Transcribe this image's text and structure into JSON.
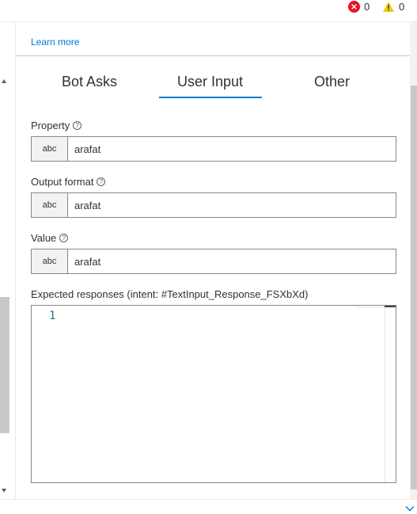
{
  "status": {
    "errors": "0",
    "warnings": "0"
  },
  "learn_more": "Learn more",
  "tabs": [
    {
      "label": "Bot Asks"
    },
    {
      "label": "User Input",
      "active": true
    },
    {
      "label": "Other"
    }
  ],
  "fields": {
    "property": {
      "label": "Property",
      "type": "abc",
      "value": "arafat"
    },
    "output_format": {
      "label": "Output format",
      "type": "abc",
      "value": "arafat"
    },
    "value": {
      "label": "Value",
      "type": "abc",
      "value": "arafat"
    }
  },
  "expected_responses": {
    "label": "Expected responses (intent: #TextInput_Response_FSXbXd)",
    "line_numbers": [
      "1"
    ]
  },
  "icons": {
    "error": "error-circle-icon",
    "warning": "warning-triangle-icon",
    "help": "question-circle-icon"
  },
  "colors": {
    "accent": "#0078d4",
    "error": "#e81123",
    "warning": "#f2c811"
  }
}
